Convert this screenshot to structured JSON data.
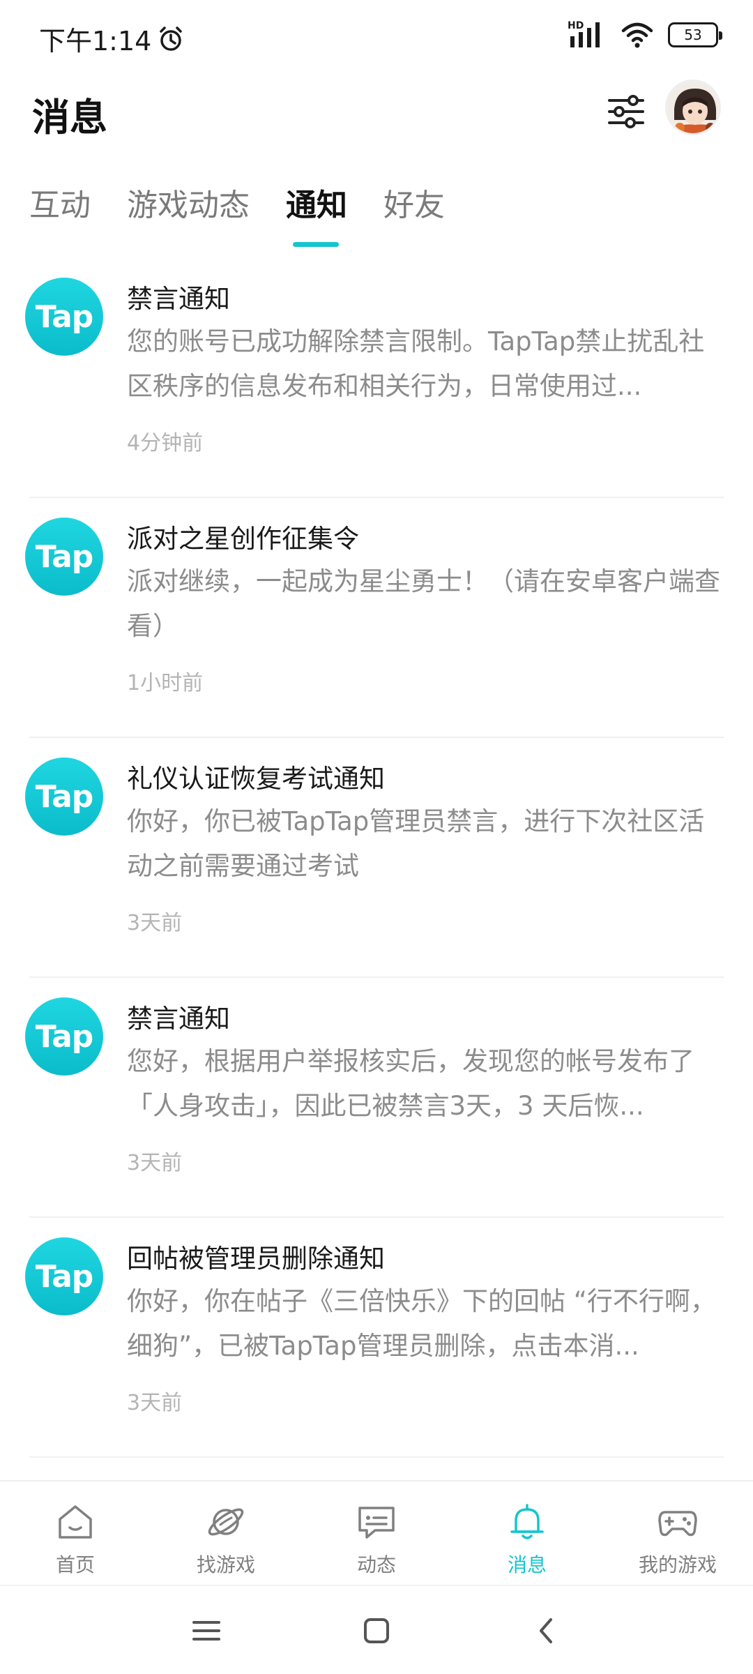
{
  "status_bar": {
    "time": "下午1:14",
    "hd_label": "HD",
    "battery": "53"
  },
  "header": {
    "title": "消息"
  },
  "tabs": [
    {
      "label": "互动",
      "active": false
    },
    {
      "label": "游戏动态",
      "active": false
    },
    {
      "label": "通知",
      "active": true
    },
    {
      "label": "好友",
      "active": false
    }
  ],
  "notifications": [
    {
      "logo": "Tap",
      "title": "禁言通知",
      "body": "您的账号已成功解除禁言限制。TapTap禁止扰乱社区秩序的信息发布和相关行为，日常使用过...",
      "time": "4分钟前"
    },
    {
      "logo": "Tap",
      "title": "派对之星创作征集令",
      "body": "派对继续，一起成为星尘勇士！（请在安卓客户端查看）",
      "time": "1小时前"
    },
    {
      "logo": "Tap",
      "title": "礼仪认证恢复考试通知",
      "body": "你好，你已被TapTap管理员禁言，进行下次社区活动之前需要通过考试",
      "time": "3天前"
    },
    {
      "logo": "Tap",
      "title": "禁言通知",
      "body": "您好，根据用户举报核实后，发现您的帐号发布了「人身攻击」，因此已被禁言3天，3 天后恢...",
      "time": "3天前"
    },
    {
      "logo": "Tap",
      "title": "回帖被管理员删除通知",
      "body": "你好，你在帖子《三倍快乐》下的回帖 “行不行啊，细狗”，已被TapTap管理员删除，点击本消...",
      "time": "3天前"
    }
  ],
  "bottom_nav": [
    {
      "label": "首页",
      "icon": "home-icon",
      "active": false
    },
    {
      "label": "找游戏",
      "icon": "planet-icon",
      "active": false
    },
    {
      "label": "动态",
      "icon": "chat-icon",
      "active": false
    },
    {
      "label": "消息",
      "icon": "bell-icon",
      "active": true
    },
    {
      "label": "我的游戏",
      "icon": "gamepad-icon",
      "active": false
    }
  ],
  "colors": {
    "accent": "#15c5ce",
    "logo_gradient_top": "#1fd6e0",
    "logo_gradient_bottom": "#0bbccb",
    "muted_text": "#8c8c8c",
    "time_text": "#b4b4b4"
  }
}
